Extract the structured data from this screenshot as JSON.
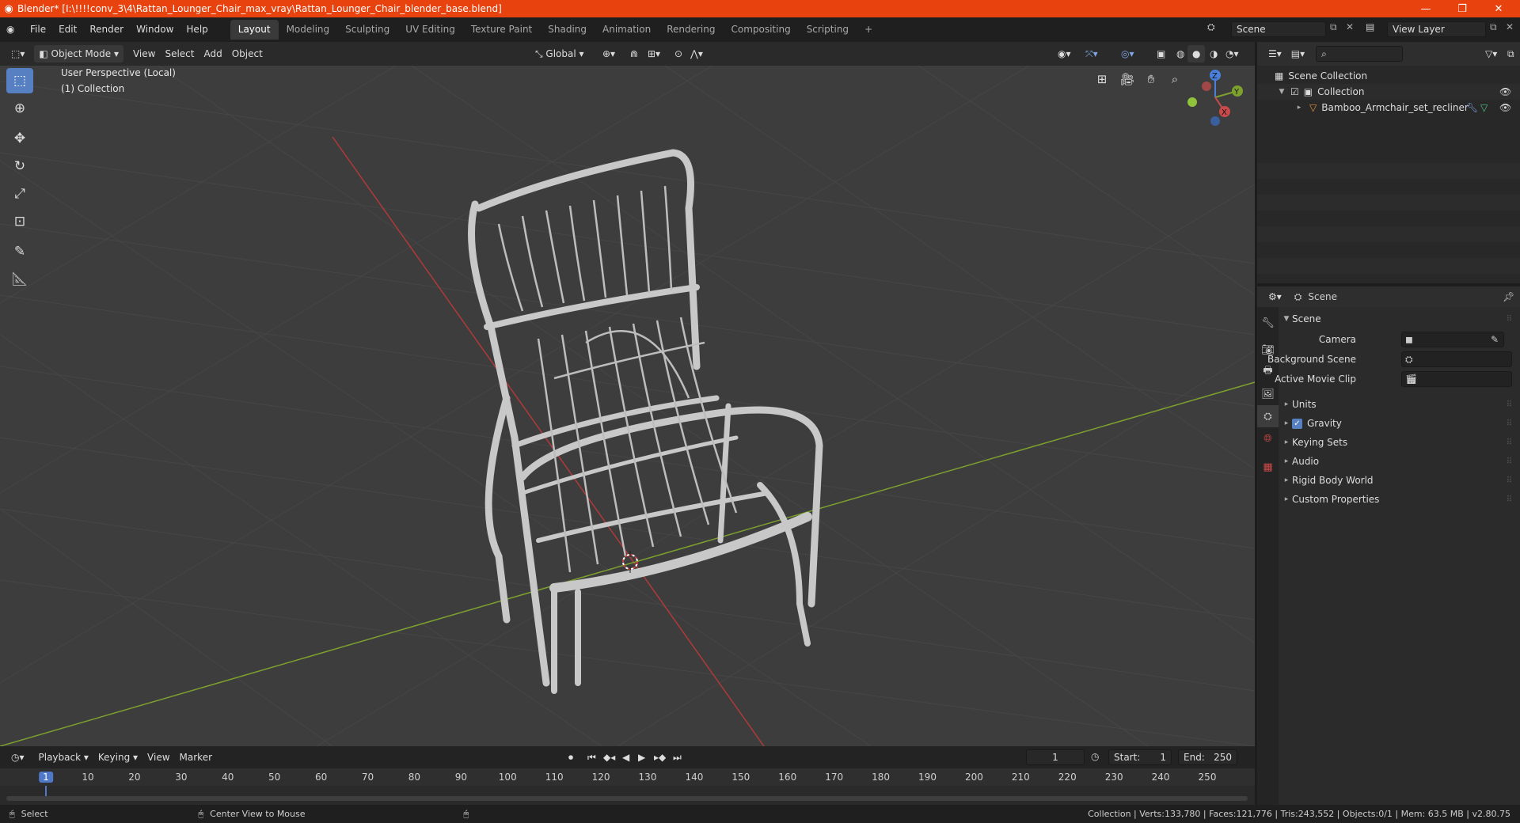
{
  "titlebar": {
    "title": "Blender* [I:\\!!!!conv_3\\4\\Rattan_Lounger_Chair_max_vray\\Rattan_Lounger_Chair_blender_base.blend]",
    "minimize": "—",
    "maximize": "❐",
    "close": "✕",
    "color": "#e8420f"
  },
  "menubar": {
    "items": [
      "File",
      "Edit",
      "Render",
      "Window",
      "Help"
    ]
  },
  "workspaces": {
    "tabs": [
      "Layout",
      "Modeling",
      "Sculpting",
      "UV Editing",
      "Texture Paint",
      "Shading",
      "Animation",
      "Rendering",
      "Compositing",
      "Scripting"
    ],
    "active": "Layout",
    "add": "+"
  },
  "scene_selector": {
    "value": "Scene"
  },
  "view_layer_selector": {
    "value": "View Layer"
  },
  "viewport_header": {
    "mode": "Object Mode",
    "menus": [
      "View",
      "Select",
      "Add",
      "Object"
    ],
    "transform_orientation": "Global"
  },
  "viewport": {
    "perspective_label": "User Perspective (Local)",
    "collection_label": "(1) Collection",
    "gizmo": {
      "z": "Z",
      "y": "Y",
      "x": "X"
    }
  },
  "outliner": {
    "search_placeholder": "",
    "scene_collection": "Scene Collection",
    "collection": "Collection",
    "object": "Bamboo_Armchair_set_recliner"
  },
  "properties": {
    "header_title": "Scene",
    "panel_title": "Scene",
    "camera_label": "Camera",
    "camera_value": "",
    "background_scene_label": "Background Scene",
    "background_scene_value": "",
    "active_movie_clip_label": "Active Movie Clip",
    "active_movie_clip_value": "",
    "sections": [
      "Units",
      "Gravity",
      "Keying Sets",
      "Audio",
      "Rigid Body World",
      "Custom Properties"
    ],
    "gravity_checked": true
  },
  "timeline": {
    "menus": [
      "Playback",
      "Keying",
      "View",
      "Marker"
    ],
    "current_frame": "1",
    "start_label": "Start:",
    "start_value": "1",
    "end_label": "End:",
    "end_value": "250",
    "ruler_ticks": [
      "1",
      "10",
      "20",
      "30",
      "40",
      "50",
      "60",
      "70",
      "80",
      "90",
      "100",
      "110",
      "120",
      "130",
      "140",
      "150",
      "160",
      "170",
      "180",
      "190",
      "200",
      "210",
      "220",
      "230",
      "240",
      "250"
    ],
    "playhead_frame": 1
  },
  "statusbar": {
    "left_action": "Select",
    "middle_action": "Center View to Mouse",
    "stats": "Collection | Verts:133,780 | Faces:121,776 | Tris:243,552 | Objects:0/1 | Mem: 63.5 MB | v2.80.75"
  },
  "colors": {
    "accent": "#5680c2",
    "axis_x": "#b03a3a",
    "axis_y": "#7da12e",
    "viewport_bg": "#3d3d3d"
  }
}
